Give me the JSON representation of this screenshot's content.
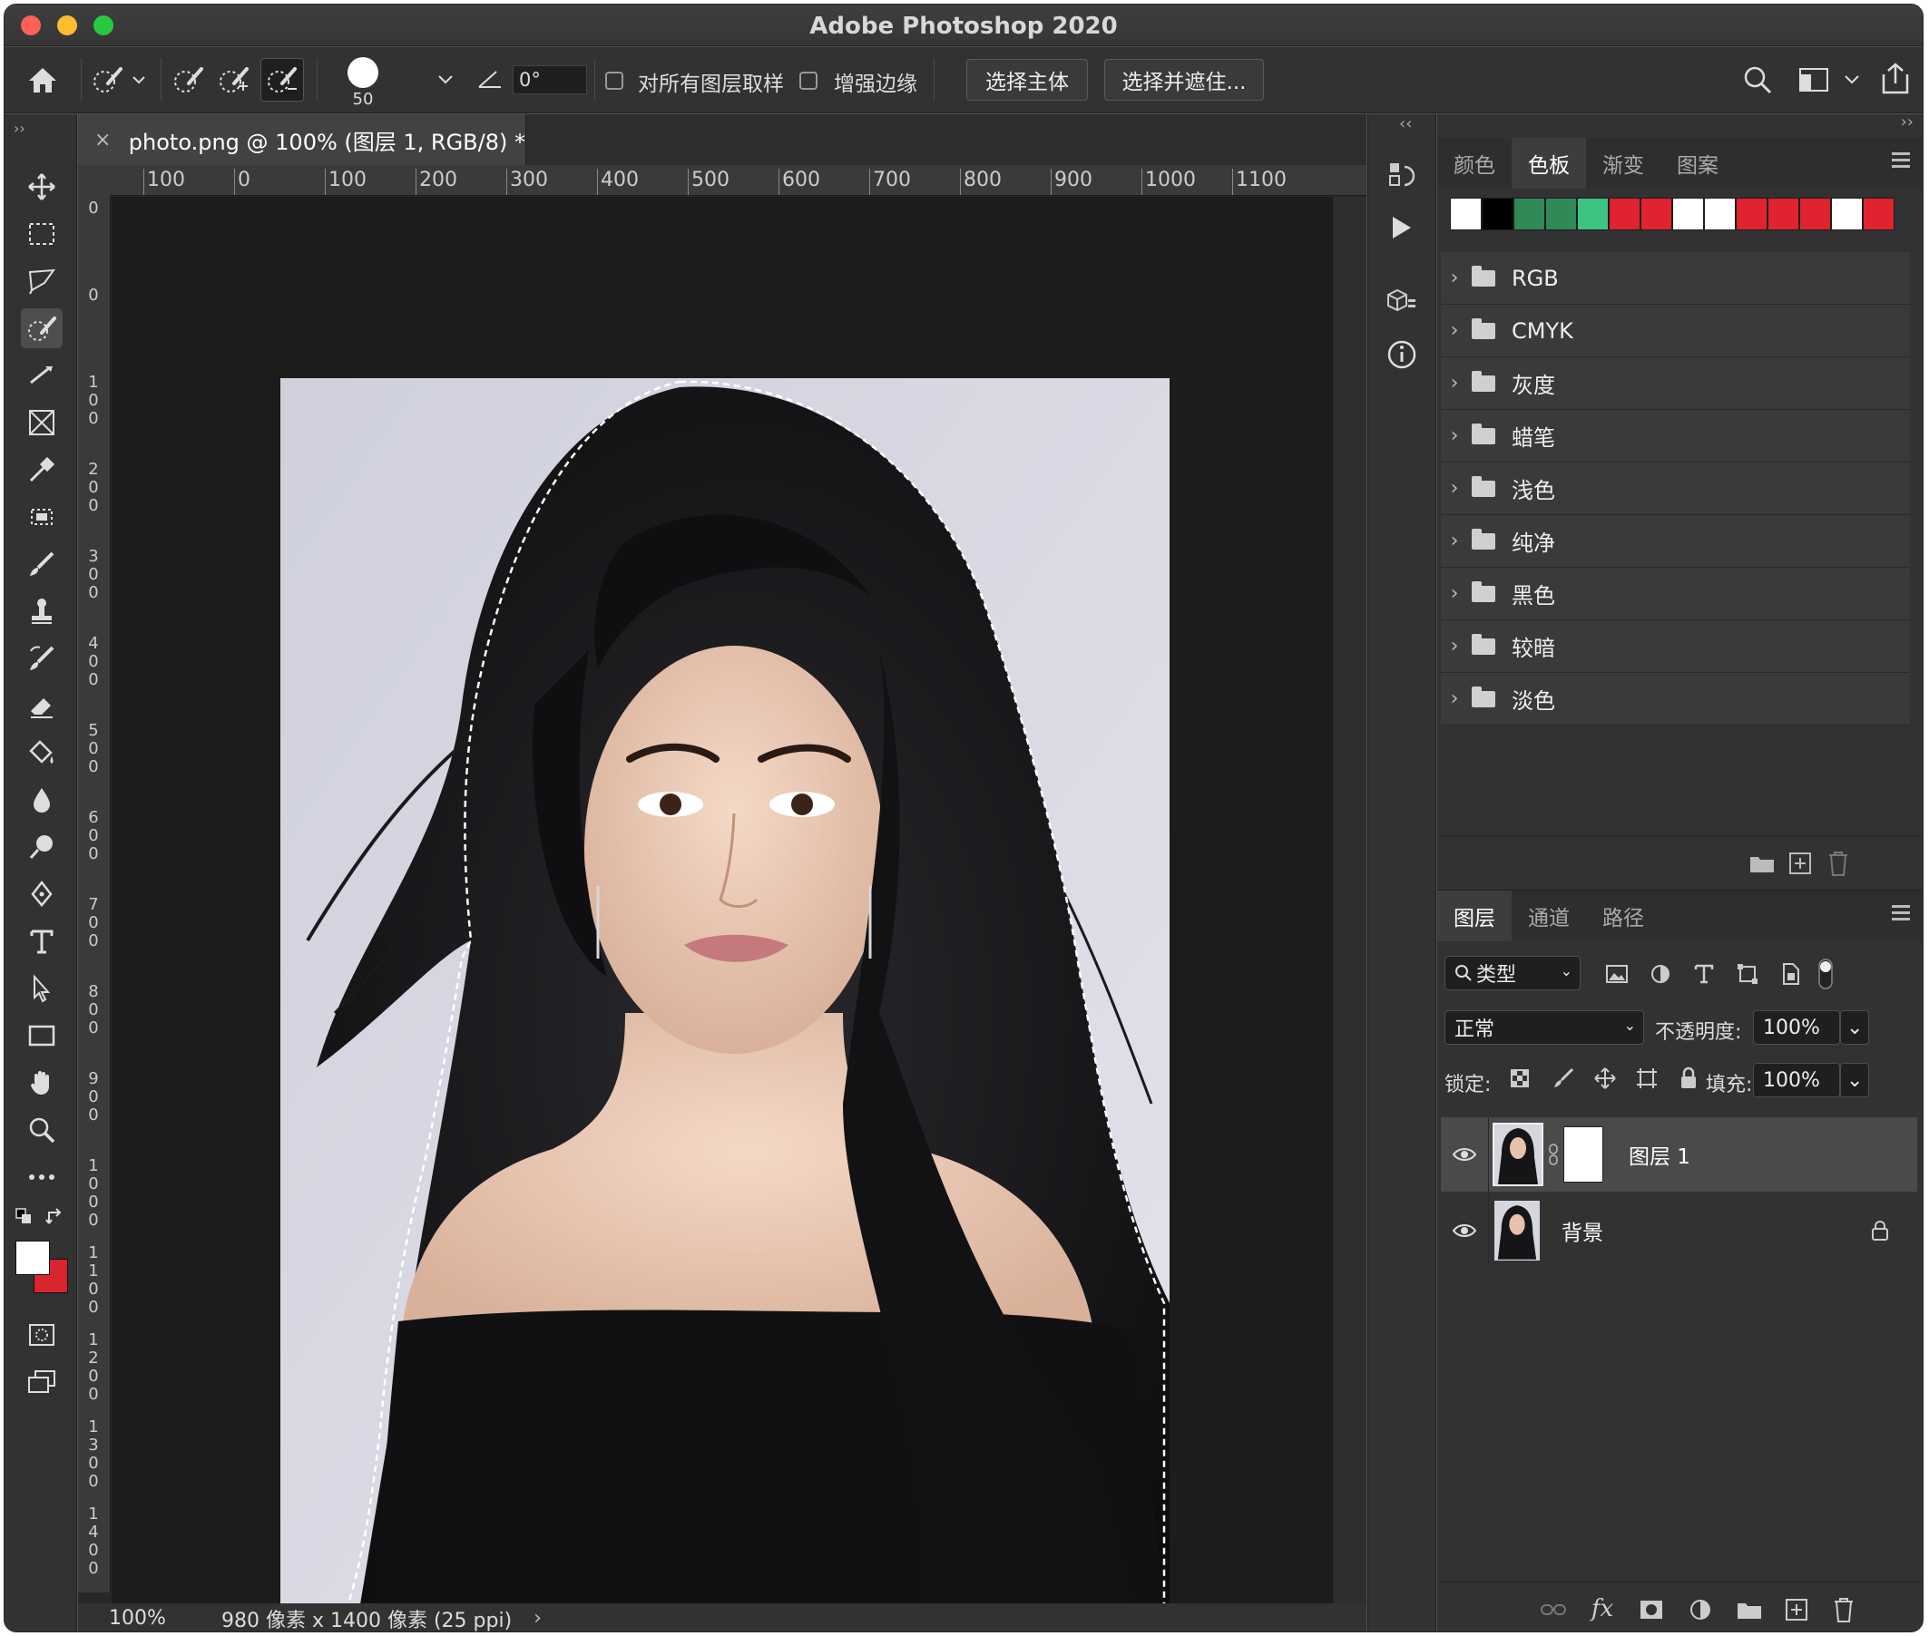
{
  "app": {
    "title": "Adobe Photoshop 2020"
  },
  "options_bar": {
    "brush_size": "50",
    "angle_value": "0°",
    "sample_all_layers_label": "对所有图层取样",
    "enhance_edge_label": "增强边缘",
    "select_subject_label": "选择主体",
    "select_and_mask_label": "选择并遮住..."
  },
  "document": {
    "tab_title": "photo.png @ 100% (图层 1, RGB/8) *",
    "zoom": "100%",
    "info": "980 像素 x 1400 像素 (25 ppi)",
    "ruler_h": [
      "100",
      "0",
      "100",
      "200",
      "300",
      "400",
      "500",
      "600",
      "700",
      "800",
      "900",
      "1000",
      "1100"
    ],
    "ruler_v": [
      "0",
      "0",
      "100",
      "200",
      "300",
      "400",
      "500",
      "600",
      "700",
      "800",
      "900",
      "1000",
      "1100",
      "1200",
      "1300",
      "1400"
    ]
  },
  "swatch_panel": {
    "tabs": [
      "颜色",
      "色板",
      "渐变",
      "图案"
    ],
    "active_tab": "色板",
    "swatches": [
      "#ffffff",
      "#000000",
      "#2f8a57",
      "#2f8a57",
      "#3fc383",
      "#e0242f",
      "#e0242f",
      "#ffffff",
      "#ffffff",
      "#e0242f",
      "#e0242f",
      "#e0242f",
      "#ffffff",
      "#e0242f"
    ],
    "groups": [
      "RGB",
      "CMYK",
      "灰度",
      "蜡笔",
      "浅色",
      "纯净",
      "黑色",
      "较暗",
      "淡色"
    ]
  },
  "layers_panel": {
    "tabs": [
      "图层",
      "通道",
      "路径"
    ],
    "active_tab": "图层",
    "filter_label": "类型",
    "blend_mode": "正常",
    "opacity_label": "不透明度:",
    "opacity_value": "100%",
    "lock_label": "锁定:",
    "fill_label": "填充:",
    "fill_value": "100%",
    "layers": [
      {
        "name": "图层 1",
        "selected": true,
        "has_mask": true
      },
      {
        "name": "背景",
        "selected": false,
        "locked": true
      }
    ]
  },
  "colors": {
    "foreground": "#ffffff",
    "background": "#d9262e"
  }
}
